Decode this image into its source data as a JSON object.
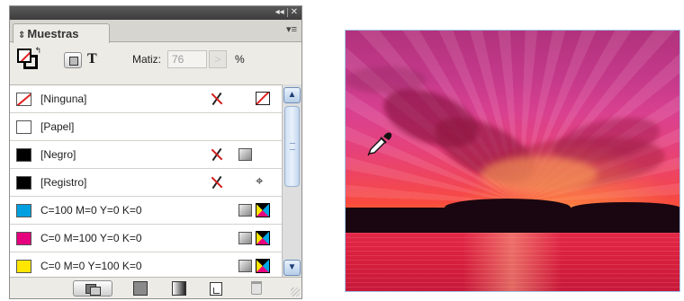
{
  "panel": {
    "title_buttons": {
      "collapse": "◂◂",
      "close": "✕"
    },
    "tab": {
      "arrow": "⇕",
      "label": "Muestras"
    },
    "menu_glyph": "▾≡",
    "text_toggle_label": "T",
    "tint": {
      "label": "Matiz:",
      "value": "76",
      "arrow": ">",
      "unit": "%"
    },
    "swatches": [
      {
        "name": "[Ninguna]",
        "color": "none",
        "icons": [
          "non-editable",
          "none-mode"
        ]
      },
      {
        "name": "[Papel]",
        "color": "#ffffff",
        "icons": []
      },
      {
        "name": "[Negro]",
        "color": "#000000",
        "icons": [
          "non-editable",
          "process-color"
        ]
      },
      {
        "name": "[Registro]",
        "color": "#000000",
        "icons": [
          "non-editable",
          "registration"
        ]
      },
      {
        "name": "C=100 M=0 Y=0 K=0",
        "color": "#00a0e0",
        "icons": [
          "process-color",
          "cmyk"
        ]
      },
      {
        "name": "C=0 M=100 Y=0 K=0",
        "color": "#e5007e",
        "icons": [
          "process-color",
          "cmyk"
        ]
      },
      {
        "name": "C=0 M=0 Y=100 K=0",
        "color": "#ffe600",
        "icons": [
          "process-color",
          "cmyk"
        ]
      }
    ],
    "scrollbar": {
      "up": "▲",
      "down": "▼"
    },
    "registration_glyph": "⌖"
  },
  "colors": {
    "accent_red": "#e02020",
    "panel_bg": "#ecebe6",
    "scroll_blue": "#b5cde8"
  }
}
